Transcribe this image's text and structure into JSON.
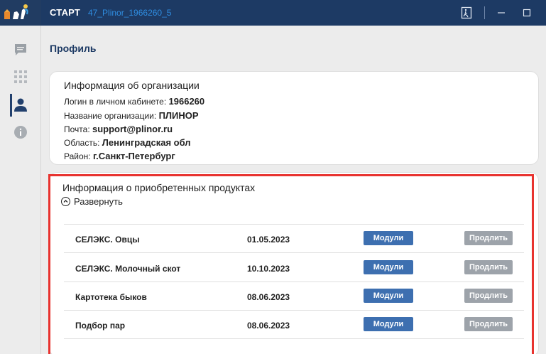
{
  "titlebar": {
    "app_name": "СТАРТ",
    "instance_id": "47_Plinor_1966260_5"
  },
  "sidebar": {
    "items": [
      {
        "icon": "chat-icon"
      },
      {
        "icon": "grid-icon"
      },
      {
        "icon": "user-icon",
        "active": true
      },
      {
        "icon": "info-icon"
      }
    ]
  },
  "page": {
    "title": "Профиль"
  },
  "org": {
    "title": "Информация об организации",
    "login_label": "Логин в личном кабинете:",
    "login_value": "1966260",
    "name_label": "Название организации:",
    "name_value": "ПЛИНОР",
    "email_label": "Почта:",
    "email_value": "support@plinor.ru",
    "region_label": "Область:",
    "region_value": "Ленинградская обл",
    "district_label": "Район:",
    "district_value": "г.Санкт-Петербург"
  },
  "products": {
    "title": "Информация о приобретенных продуктах",
    "expand_label": "Развернуть",
    "modules_label": "Модули",
    "extend_label": "Продлить",
    "rows": [
      {
        "name": "СЕЛЭКС. Овцы",
        "date": "01.05.2023"
      },
      {
        "name": "СЕЛЭКС. Молочный скот",
        "date": "10.10.2023"
      },
      {
        "name": "Картотека быков",
        "date": "08.06.2023"
      },
      {
        "name": "Подбор пар",
        "date": "08.06.2023"
      }
    ]
  },
  "colors": {
    "titlebar": "#1d3a64",
    "accent_button": "#3d6fb0",
    "disabled_button": "#9da3aa",
    "highlight": "#e8332f"
  }
}
